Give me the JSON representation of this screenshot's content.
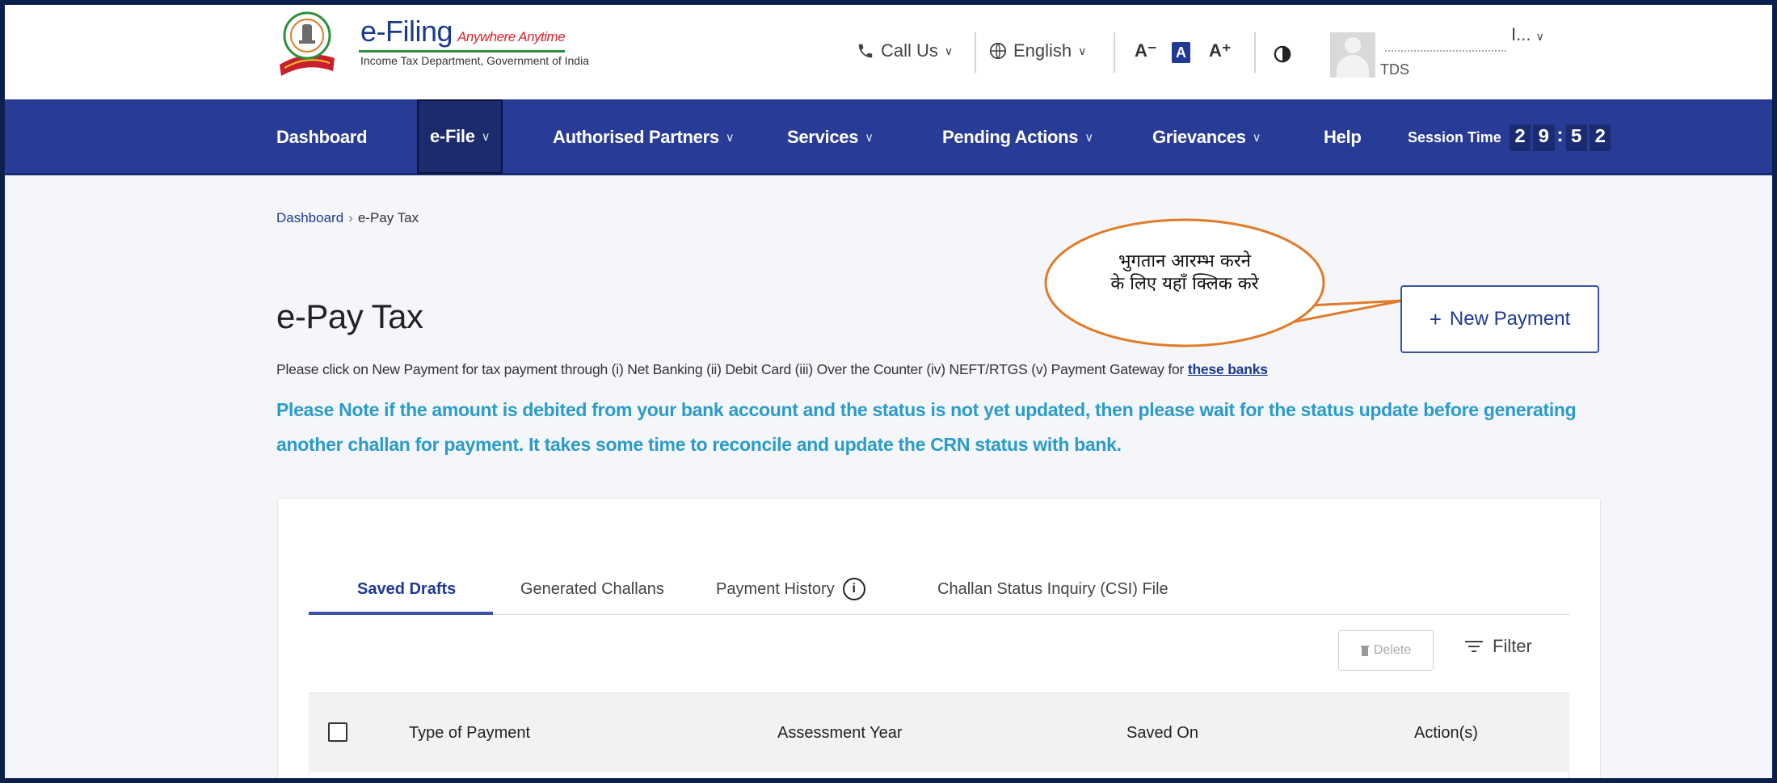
{
  "header": {
    "logo_title": "e-Filing",
    "logo_tagline": "Anywhere Anytime",
    "logo_subtitle": "Income Tax Department, Government of India",
    "call_us": "Call Us",
    "language": "English",
    "font_decrease": "A⁻",
    "font_normal": "A",
    "font_increase": "A⁺",
    "contrast_icon": "contrast-icon",
    "user_abbr": "I...",
    "user_role": "TDS"
  },
  "nav": {
    "items": [
      {
        "label": "Dashboard",
        "chevron": false
      },
      {
        "label": "e-File",
        "chevron": true
      },
      {
        "label": "Authorised Partners",
        "chevron": true
      },
      {
        "label": "Services",
        "chevron": true
      },
      {
        "label": "Pending Actions",
        "chevron": true
      },
      {
        "label": "Grievances",
        "chevron": true
      },
      {
        "label": "Help",
        "chevron": false
      }
    ],
    "session_label": "Session Time",
    "session_digits": [
      "2",
      "9",
      ":",
      "5",
      "2"
    ]
  },
  "breadcrumb": {
    "root": "Dashboard",
    "current": "e-Pay Tax"
  },
  "page": {
    "title": "e-Pay Tax",
    "new_payment_label": "New Payment",
    "callout_line1": "भुगतान आरम्भ करने",
    "callout_line2": "के लिए यहाँ क्लिक करे",
    "instruction": "Please click on New Payment for tax payment through (i) Net Banking (ii) Debit Card (iii) Over the Counter (iv) NEFT/RTGS (v) Payment Gateway for ",
    "instruction_link": "these banks",
    "note": "Please Note if the amount is debited from your bank account and the status is not yet updated, then please wait for the status update before generating another challan for payment. It takes some time to reconcile and update the CRN status with bank."
  },
  "tabs": [
    "Saved Drafts",
    "Generated Challans",
    "Payment History",
    "Challan Status Inquiry (CSI) File"
  ],
  "toolbar": {
    "delete_label": "Delete",
    "filter_label": "Filter"
  },
  "table": {
    "columns": [
      "Type of Payment",
      "Assessment Year",
      "Saved On",
      "Action(s)"
    ]
  },
  "colors": {
    "nav_bg": "#283b96",
    "accent": "#1f3a93",
    "note_text": "#2b9bc8",
    "callout_border": "#e07b2a"
  }
}
